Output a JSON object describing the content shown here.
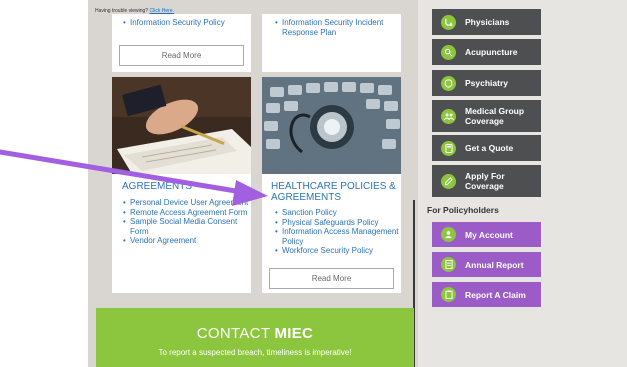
{
  "trouble": {
    "text": "Having trouble viewing?",
    "link": "Click Here."
  },
  "top_left": {
    "items": [
      "Information Security Policy"
    ],
    "button": "Read More"
  },
  "top_right": {
    "items": [
      "Information Security Incident Response Plan"
    ]
  },
  "agreements": {
    "title": "AGREEMENTS",
    "items": [
      "Personal Device User Agreement",
      "Remote Access Agreement Form",
      "Sample Social Media Consent Form",
      "Vendor Agreement"
    ]
  },
  "healthcare": {
    "title": "HEALTHCARE POLICIES & AGREEMENTS",
    "items": [
      "Sanction Policy",
      "Physical Safeguards Policy",
      "Information Access Management Policy",
      "Workforce Security Policy"
    ],
    "button": "Read More"
  },
  "contact": {
    "title_light": "CONTACT",
    "title_bold": "MIEC",
    "sub": "To report a suspected breach, timeliness is imperative!"
  },
  "sidebar": {
    "buttons": [
      {
        "label": "Physicians",
        "icon": "stethoscope-icon"
      },
      {
        "label": "Acupuncture",
        "icon": "acupuncture-icon"
      },
      {
        "label": "Psychiatry",
        "icon": "brain-icon"
      },
      {
        "label": "Medical Group Coverage",
        "icon": "group-icon"
      },
      {
        "label": "Get a Quote",
        "icon": "calculator-icon"
      },
      {
        "label": "Apply For Coverage",
        "icon": "pen-icon"
      }
    ],
    "policyholders_heading": "For Policyholders",
    "policy_buttons": [
      {
        "label": "My Account",
        "icon": "user-icon"
      },
      {
        "label": "Annual Report",
        "icon": "document-icon"
      },
      {
        "label": "Report A Claim",
        "icon": "clipboard-icon"
      }
    ]
  },
  "colors": {
    "accent_green": "#8cc63f",
    "purple": "#9b5cc7",
    "dark_button": "#4e4f51",
    "link_blue": "#2b73b8",
    "arrow": "#a25fe0"
  }
}
